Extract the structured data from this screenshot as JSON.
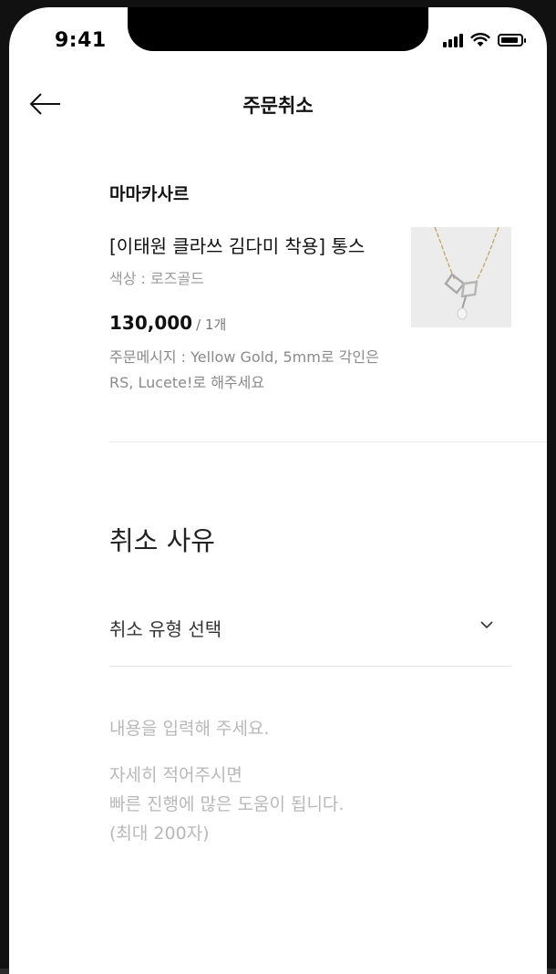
{
  "status_bar": {
    "time": "9:41"
  },
  "header": {
    "title": "주문취소"
  },
  "order": {
    "store_name": "마마카사르",
    "product_name": "[이태원 클라쓰 김다미 착용] 통스",
    "option": "색상 : 로즈골드",
    "price": "130,000",
    "quantity": "/ 1개",
    "memo": "주문메시지 : Yellow Gold, 5mm로 각인은 RS, Lucete!로 해주세요"
  },
  "cancel": {
    "section_title": "취소 사유",
    "type_select_placeholder": "취소 유형 선택",
    "content_placeholder_line1": "내용을 입력해 주세요.",
    "content_placeholder_rest": "자세히 적어주시면\n빠른 진행에 많은 도움이 됩니다.\n(최대 200자)"
  },
  "icons": {
    "back": "arrow-left-icon",
    "chevron": "chevron-down-icon"
  }
}
